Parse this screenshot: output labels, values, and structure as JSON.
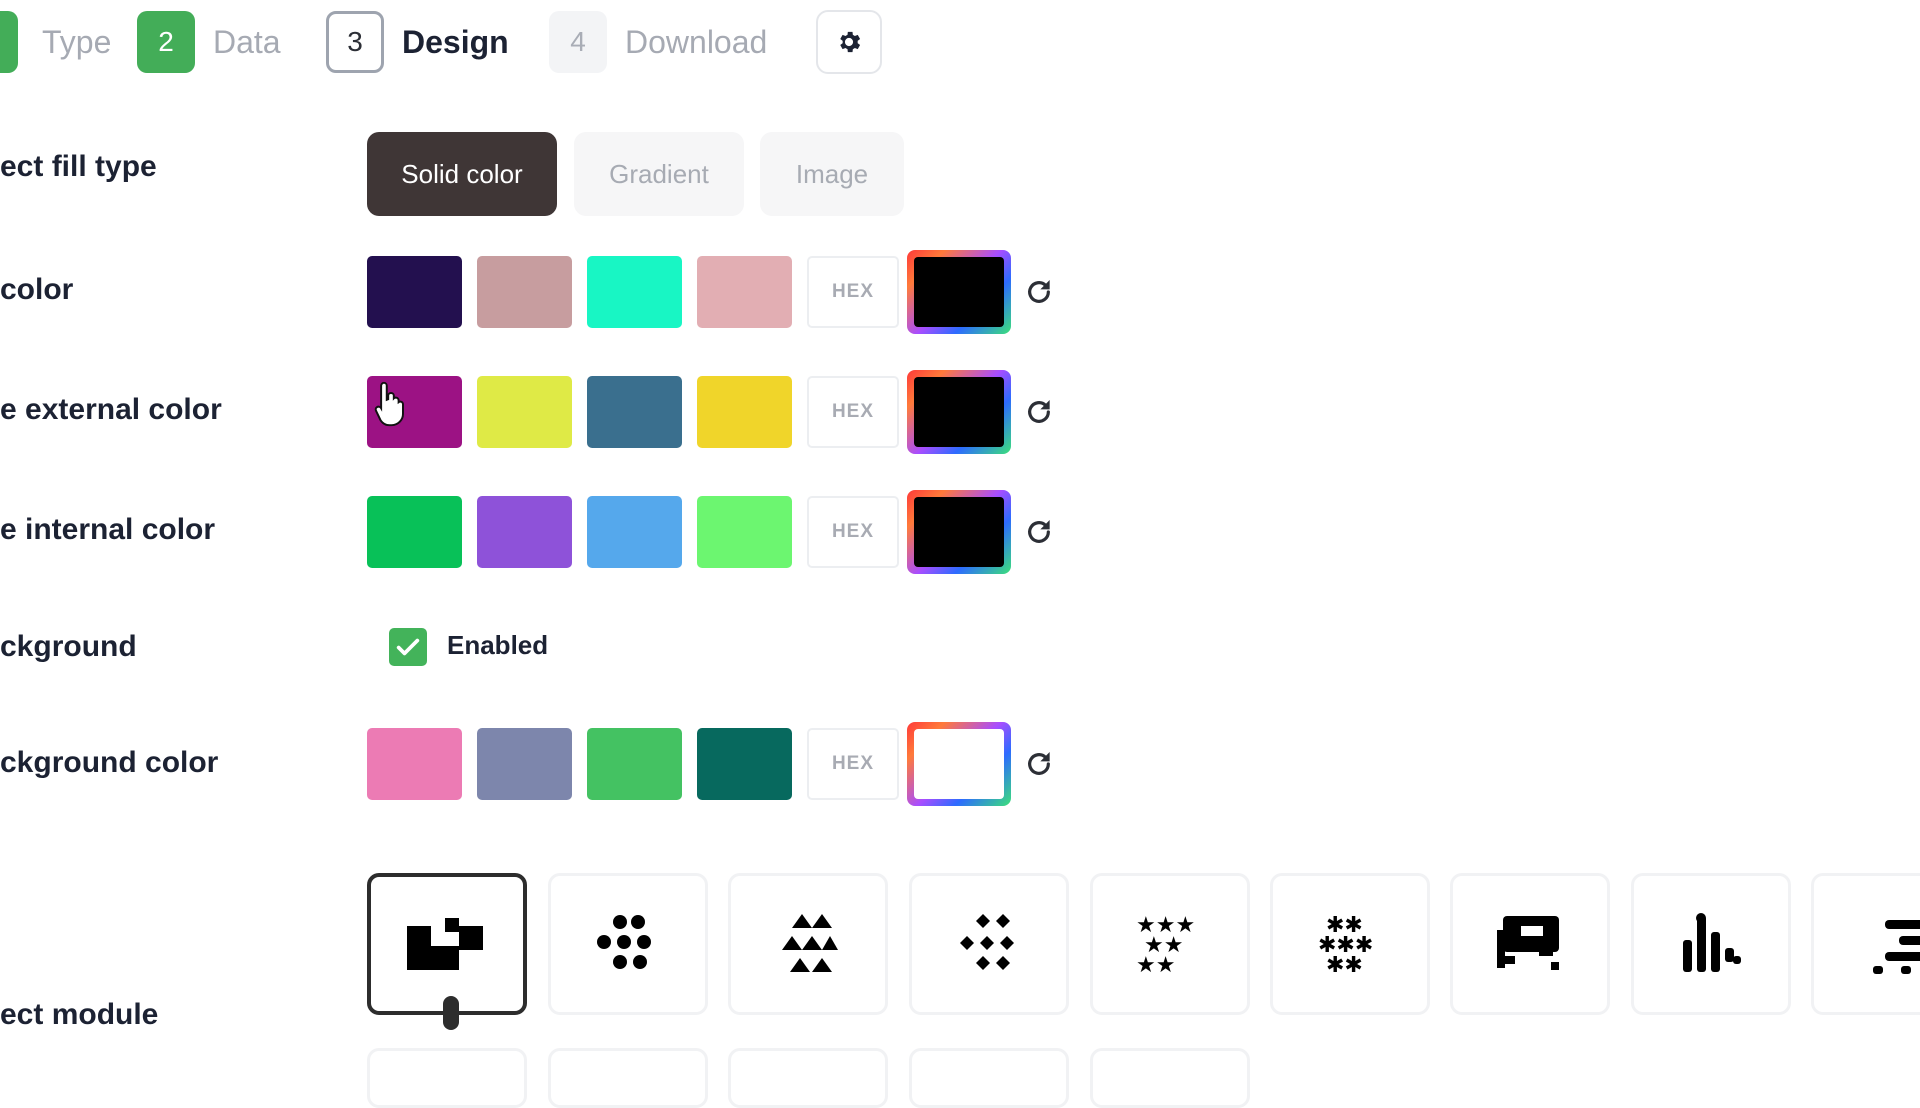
{
  "steps": [
    {
      "number": "",
      "label": "Type",
      "state": "done"
    },
    {
      "number": "2",
      "label": "Data",
      "state": "done"
    },
    {
      "number": "3",
      "label": "Design",
      "state": "current"
    },
    {
      "number": "4",
      "label": "Download",
      "state": "todo"
    }
  ],
  "settings_icon": "gear-icon",
  "fill_type": {
    "label": "ect fill type",
    "options": [
      "Solid color",
      "Gradient",
      "Image"
    ],
    "selected": "Solid color"
  },
  "color_rows": [
    {
      "label": " color",
      "swatches": [
        "#23104f",
        "#c79d9f",
        "#18f6c4",
        "#e2aeb3"
      ],
      "hex_placeholder": "HEX",
      "picker_value": "#000000"
    },
    {
      "label": "e external color",
      "swatches": [
        "#9c1284",
        "#dfea46",
        "#3a6f8e",
        "#f0d52a"
      ],
      "hex_placeholder": "HEX",
      "picker_value": "#000000"
    },
    {
      "label": "e internal color",
      "swatches": [
        "#08c158",
        "#8e52d9",
        "#55a8ec",
        "#6cf670"
      ],
      "hex_placeholder": "HEX",
      "picker_value": "#000000"
    },
    {
      "label": "ckground color",
      "swatches": [
        "#ec7bb4",
        "#7d86ac",
        "#44c262",
        "#07695e"
      ],
      "hex_placeholder": "HEX",
      "picker_value": "#ffffff"
    }
  ],
  "background": {
    "label": "ckground",
    "checkbox_label": "Enabled",
    "checked": true
  },
  "module": {
    "label": "ect module",
    "options": [
      "square-blocks-icon",
      "dots-icon",
      "triangles-icon",
      "diamond-dots-icon",
      "stars-icon",
      "snowflake-dots-icon",
      "frame-blocks-icon",
      "bars-icon",
      "lines-icon"
    ],
    "selected": "square-blocks-icon"
  },
  "reset_icon": "refresh-icon",
  "accent_color": "#43ad58"
}
